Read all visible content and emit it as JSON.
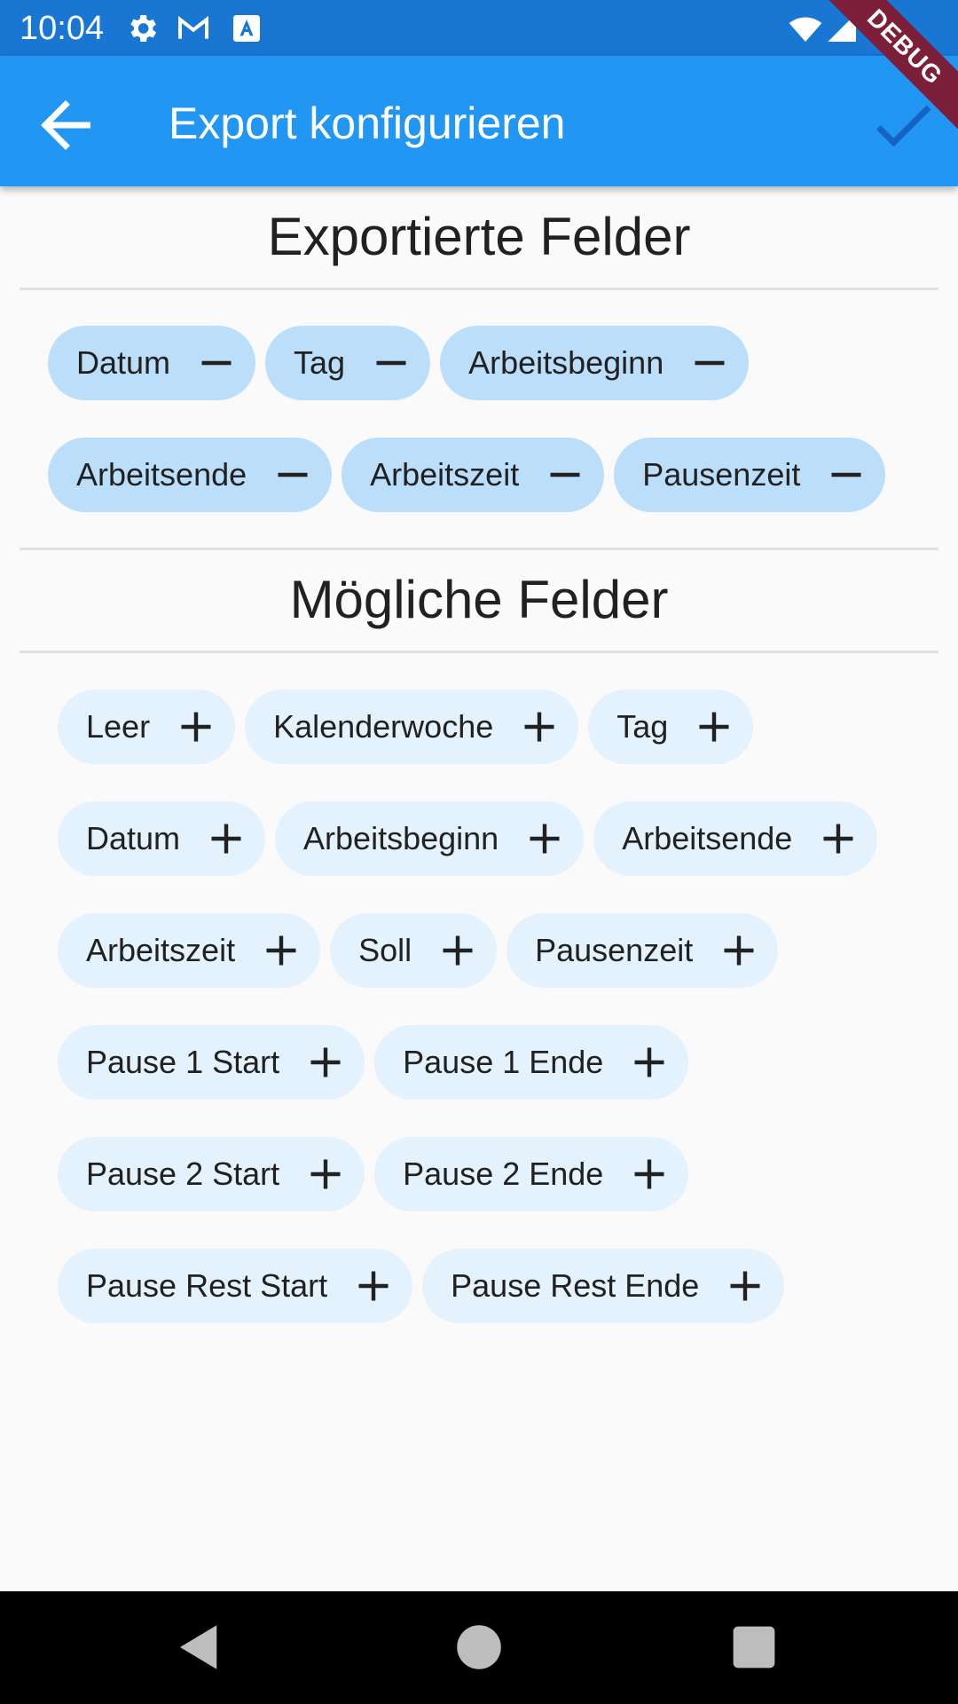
{
  "status_bar": {
    "time": "10:04",
    "icons": [
      "gear-icon",
      "gmail-icon",
      "text-a-icon",
      "wifi-icon",
      "signal-icon",
      "battery-icon"
    ],
    "debug_label": "DEBUG"
  },
  "app_bar": {
    "title": "Export konfigurieren",
    "back_icon": "arrow-back-icon",
    "confirm_icon": "check-icon"
  },
  "exported": {
    "title": "Exportierte Felder",
    "chips": [
      "Datum",
      "Tag",
      "Arbeitsbeginn",
      "Arbeitsende",
      "Arbeitszeit",
      "Pausenzeit"
    ]
  },
  "possible": {
    "title": "Mögliche Felder",
    "chips": [
      "Leer",
      "Kalenderwoche",
      "Tag",
      "Datum",
      "Arbeitsbeginn",
      "Arbeitsende",
      "Arbeitszeit",
      "Soll",
      "Pausenzeit",
      "Pause 1 Start",
      "Pause 1 Ende",
      "Pause 2 Start",
      "Pause 2 Ende",
      "Pause Rest Start",
      "Pause Rest Ende"
    ]
  },
  "colors": {
    "status_bar": "#1976d2",
    "app_bar": "#2196f3",
    "exported_chip": "#bbdefb",
    "possible_chip": "#e3f2fd"
  },
  "nav_bar": {
    "icons": [
      "back-triangle-icon",
      "home-circle-icon",
      "recents-square-icon"
    ]
  }
}
